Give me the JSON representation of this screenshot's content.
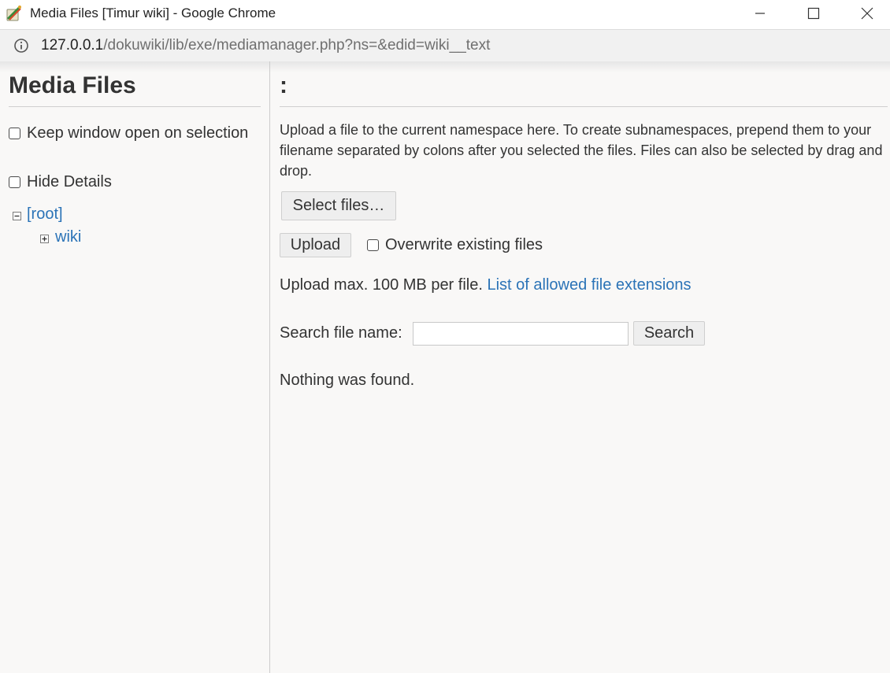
{
  "window": {
    "title": "Media Files [Timur wiki] - Google Chrome",
    "controls": {
      "minimize": "minimize-icon",
      "maximize": "maximize-icon",
      "close": "close-icon"
    }
  },
  "address_bar": {
    "url_host": "127.0.0.1",
    "url_path": "/dokuwiki/lib/exe/mediamanager.php?ns=&edid=wiki__text"
  },
  "sidebar": {
    "title": "Media Files",
    "options": [
      {
        "label": "Keep window open on selection",
        "checked": false
      },
      {
        "label": "Hide Details",
        "checked": false
      }
    ],
    "tree": [
      {
        "label": "[root]",
        "state": "expanded"
      },
      {
        "label": "wiki",
        "state": "collapsed"
      }
    ]
  },
  "main": {
    "namespace_title": ":",
    "upload_intro": "Upload a file to the current namespace here. To create subnamespaces, prepend them to your filename separated by colons after you selected the files. Files can also be selected by drag and drop.",
    "select_files_label": "Select files…",
    "upload_label": "Upload",
    "overwrite_label": "Overwrite existing files",
    "upload_max_text": "Upload max. 100 MB per file.",
    "allowed_extensions_link": "List of allowed file extensions",
    "search_label": "Search file name:",
    "search_value": "",
    "search_button": "Search",
    "result_text": "Nothing was found."
  },
  "colors": {
    "link": "#2b73b7",
    "page_bg": "#f9f8f7",
    "text": "#333333"
  }
}
